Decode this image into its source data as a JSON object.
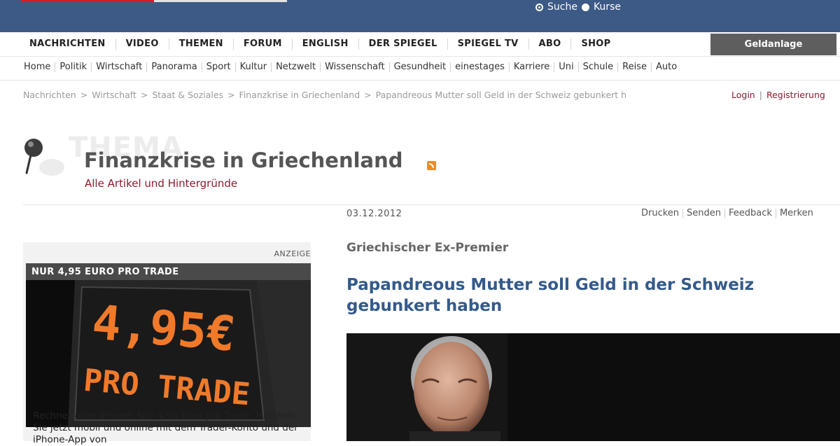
{
  "header": {
    "search_options": [
      {
        "label": "Suche",
        "selected": true
      },
      {
        "label": "Kurse",
        "selected": false
      }
    ]
  },
  "main_nav": {
    "items": [
      "NACHRICHTEN",
      "VIDEO",
      "THEMEN",
      "FORUM",
      "ENGLISH",
      "DER SPIEGEL",
      "SPIEGEL TV",
      "ABO",
      "SHOP"
    ],
    "highlight": "Geldanlage"
  },
  "sub_nav": {
    "items": [
      "Home",
      "Politik",
      "Wirtschaft",
      "Panorama",
      "Sport",
      "Kultur",
      "Netzwelt",
      "Wissenschaft",
      "Gesundheit",
      "einestages",
      "Karriere",
      "Uni",
      "Schule",
      "Reise",
      "Auto"
    ]
  },
  "breadcrumb": {
    "items": [
      "Nachrichten",
      "Wirtschaft",
      "Staat & Soziales",
      "Finanzkrise in Griechenland",
      "Papandreous Mutter soll Geld in der Schweiz gebunkert h"
    ],
    "separator": ">",
    "login": "Login",
    "register": "Registrierung"
  },
  "thema": {
    "watermark": "THEMA",
    "title": "Finanzkrise in Griechenland",
    "subtitle": "Alle Artikel und Hintergründe"
  },
  "article": {
    "date": "03.12.2012",
    "tools": [
      "Drucken",
      "Senden",
      "Feedback",
      "Merken"
    ],
    "kicker": "Griechischer Ex-Premier",
    "headline": "Papandreous Mutter soll Geld in der Schweiz gebunkert haben"
  },
  "ad": {
    "label": "ANZEIGE",
    "headline": "NUR 4,95 EURO PRO TRADE",
    "image_text_1": "4,95€",
    "image_text_2": "PRO TRADE",
    "text": "Rechner oder iPhone: Nur 4,95 Euro pro Trade. Handeln Sie jetzt mobil und online mit dem Trader-Konto und der iPhone-App von"
  },
  "colors": {
    "header_bg": "#3d5a86",
    "accent_red": "#8b1a2d",
    "headline_blue": "#345a8a",
    "ad_digit_orange": "#f07a2a"
  }
}
